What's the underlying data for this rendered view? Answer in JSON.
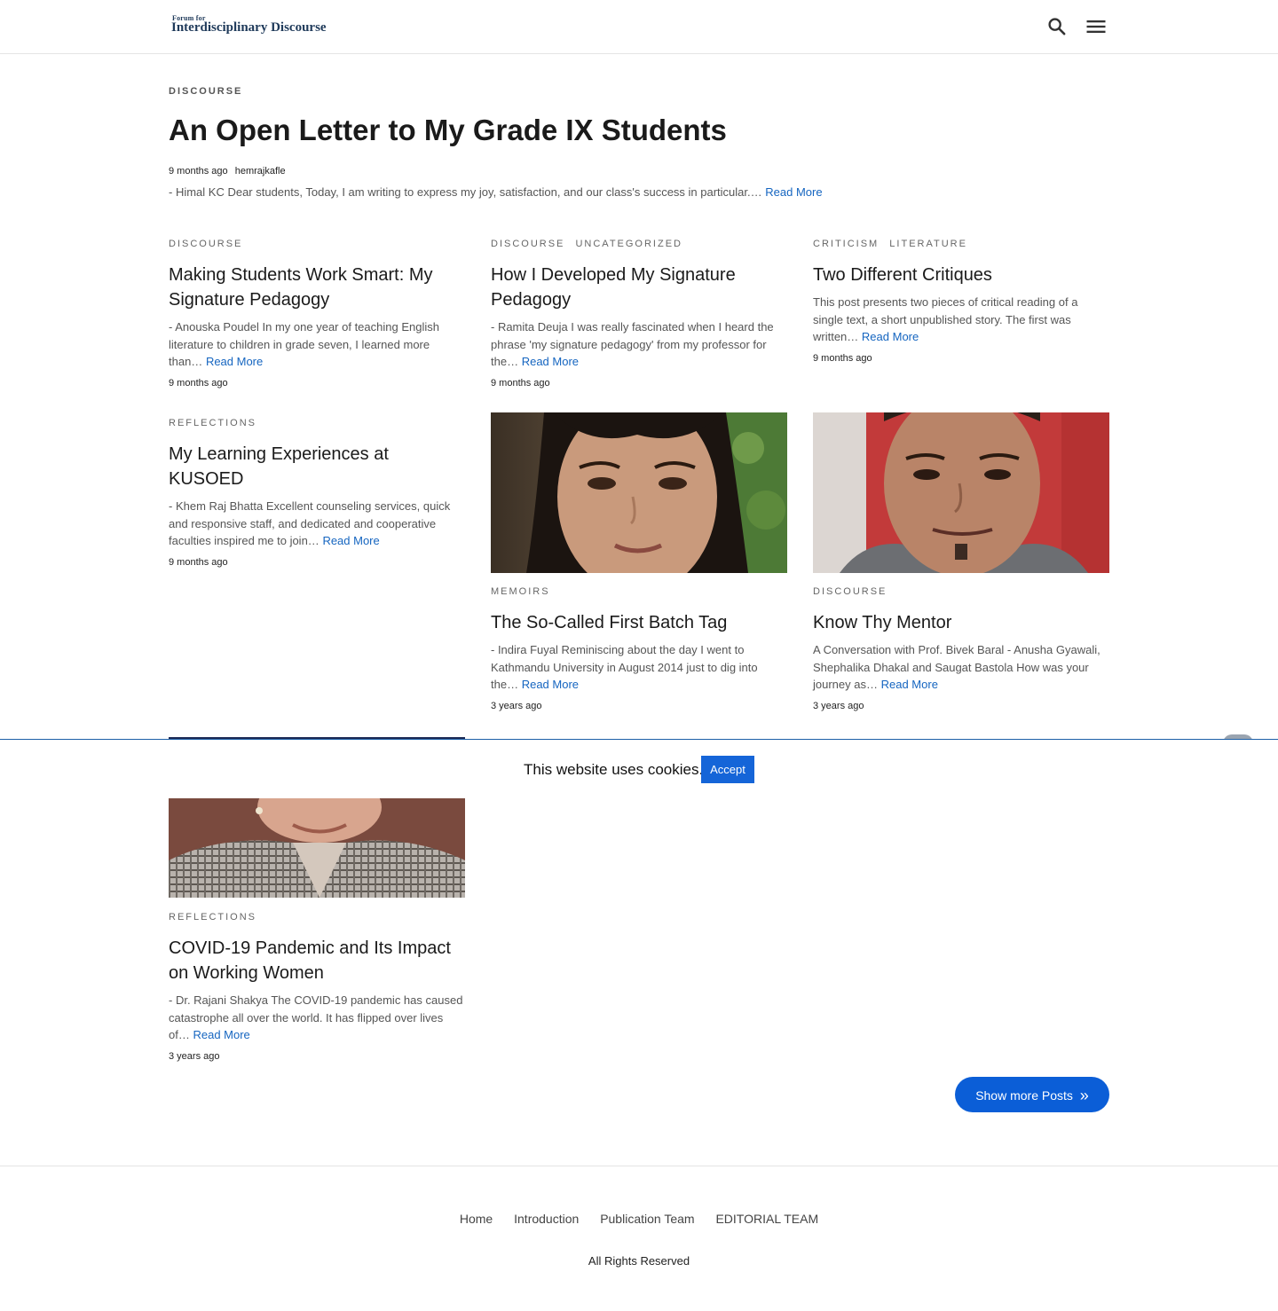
{
  "header": {
    "logo_small": "Forum for",
    "logo_big": "Interdisciplinary Discourse",
    "search_icon": "search-icon",
    "menu_icon": "hamburger-menu-icon"
  },
  "featured": {
    "category": "DISCOURSE",
    "title": "An Open Letter to My Grade IX Students",
    "time": "9 months ago",
    "author": "hemrajkafle",
    "excerpt": "- Himal KC Dear students, Today, I am writing to express my joy, satisfaction, and our class's success in particular.…",
    "read_more": "Read More"
  },
  "posts": [
    {
      "categories": [
        "DISCOURSE"
      ],
      "title": "Making Students Work Smart: My Signature Pedagogy",
      "excerpt": "-  Anouska Poudel In my one year of teaching English literature to children in grade seven, I learned more than…",
      "read_more": "Read More",
      "date": "9 months ago"
    },
    {
      "categories": [
        "DISCOURSE",
        "UNCATEGORIZED"
      ],
      "title": "How I Developed My Signature Pedagogy",
      "excerpt": "- Ramita Deuja I was really fascinated when I heard the phrase 'my signature pedagogy' from my professor for the…",
      "read_more": "Read More",
      "date": "9 months ago"
    },
    {
      "categories": [
        "CRITICISM",
        "LITERATURE"
      ],
      "title": "Two Different Critiques",
      "excerpt": "This post presents two pieces of critical reading of a single text, a short unpublished story. The first was written…",
      "read_more": "Read More",
      "date": "9 months ago"
    },
    {
      "categories": [
        "REFLECTIONS"
      ],
      "title": "My Learning Experiences at KUSOED",
      "excerpt": "- Khem Raj Bhatta Excellent counseling services, quick and responsive staff, and dedicated and cooperative faculties inspired me to join…",
      "read_more": "Read More",
      "date": "9 months ago"
    },
    {
      "categories": [
        "MEMOIRS"
      ],
      "title": "The So-Called First Batch Tag",
      "excerpt": "- Indira Fuyal Reminiscing about the day I went to Kathmandu University in August 2014 just to dig into the…",
      "read_more": "Read More",
      "date": "3 years ago"
    },
    {
      "categories": [
        "DISCOURSE"
      ],
      "title": "Know Thy Mentor",
      "excerpt": "A Conversation with Prof. Bivek Baral - Anusha Gyawali, Shephalika Dhakal and Saugat Bastola   How was your journey as…",
      "read_more": "Read More",
      "date": "3 years ago"
    },
    {
      "categories": [
        "REFLECTIONS"
      ],
      "title": "COVID-19 Pandemic and Its Impact on Working Women",
      "excerpt": "- Dr. Rajani Shakya The COVID-19 pandemic has caused catastrophe all over the world. It has flipped over lives of…",
      "read_more": "Read More",
      "date": "3 years ago"
    }
  ],
  "cookie": {
    "message": "This website uses cookies.",
    "accept_label": "Accept"
  },
  "show_more": {
    "label": "Show more Posts",
    "icon": "double-chevron-right-icon"
  },
  "footer": {
    "nav": [
      "Home",
      "Introduction",
      "Publication Team",
      "EDITORIAL TEAM"
    ],
    "copyright": "All Rights Reserved"
  },
  "colors": {
    "link": "#1565c0",
    "button": "#0b5ed7",
    "logo": "#1f3a5a"
  }
}
